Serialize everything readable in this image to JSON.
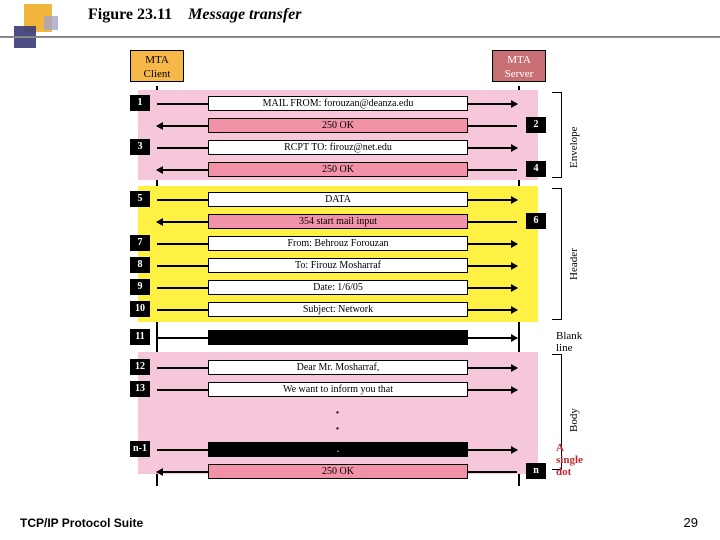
{
  "figure": {
    "number": "Figure 23.11",
    "name": "Message transfer"
  },
  "nodes": {
    "client": {
      "line1": "MTA",
      "line2": "Client"
    },
    "server": {
      "line1": "MTA",
      "line2": "Server"
    }
  },
  "rows": [
    {
      "n": "1",
      "side": "l",
      "dir": "r",
      "text": "MAIL FROM: forouzan@deanza.edu",
      "style": "plain"
    },
    {
      "n": "2",
      "side": "r",
      "dir": "l",
      "text": "250 OK",
      "style": "pink"
    },
    {
      "n": "3",
      "side": "l",
      "dir": "r",
      "text": "RCPT TO: firouz@net.edu",
      "style": "plain"
    },
    {
      "n": "4",
      "side": "r",
      "dir": "l",
      "text": "250 OK",
      "style": "pink"
    },
    {
      "n": "5",
      "side": "l",
      "dir": "r",
      "text": "DATA",
      "style": "plain"
    },
    {
      "n": "6",
      "side": "r",
      "dir": "l",
      "text": "354 start mail input",
      "style": "pink"
    },
    {
      "n": "7",
      "side": "l",
      "dir": "r",
      "text": "From: Behrouz Forouzan",
      "style": "plain"
    },
    {
      "n": "8",
      "side": "l",
      "dir": "r",
      "text": "To: Firouz Mosharraf",
      "style": "plain"
    },
    {
      "n": "9",
      "side": "l",
      "dir": "r",
      "text": "Date: 1/6/05",
      "style": "plain"
    },
    {
      "n": "10",
      "side": "l",
      "dir": "r",
      "text": "Subject: Network",
      "style": "plain"
    },
    {
      "n": "11",
      "side": "l",
      "dir": "r",
      "text": "",
      "style": "black"
    },
    {
      "n": "12",
      "side": "l",
      "dir": "r",
      "text": "Dear Mr. Mosharraf,",
      "style": "plain"
    },
    {
      "n": "13",
      "side": "l",
      "dir": "r",
      "text": "We want to inform you that",
      "style": "plain"
    },
    {
      "n": "n-1",
      "side": "l",
      "dir": "r",
      "text": ".",
      "style": "black"
    },
    {
      "n": "n",
      "side": "r",
      "dir": "l",
      "text": "250 OK",
      "style": "pink"
    }
  ],
  "sections": {
    "envelope": "Envelope",
    "header": "Header",
    "body": "Body",
    "blank": "Blank line",
    "singleDot": "A single dot"
  },
  "footer": {
    "left": "TCP/IP Protocol Suite",
    "page": "29"
  }
}
